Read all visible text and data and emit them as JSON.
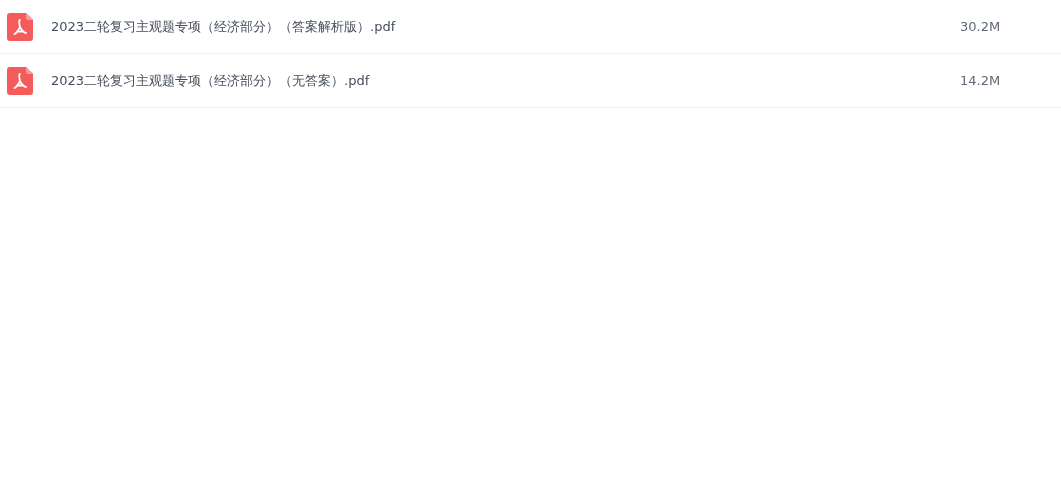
{
  "files": [
    {
      "name": "2023二轮复习主观题专项（经济部分）（答案解析版）.pdf",
      "size": "30.2M"
    },
    {
      "name": "2023二轮复习主观题专项（经济部分）（无答案）.pdf",
      "size": "14.2M"
    }
  ]
}
